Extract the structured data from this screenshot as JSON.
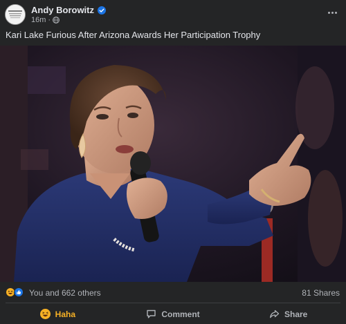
{
  "post": {
    "author": "Andy Borowitz",
    "timestamp": "16m",
    "separator": "·",
    "text": "Kari Lake Furious After Arizona Awards Her Participation Trophy"
  },
  "reactions": {
    "summary": "You and 662 others",
    "shares": "81 Shares"
  },
  "actions": {
    "haha_label": "Haha",
    "comment_label": "Comment",
    "share_label": "Share"
  },
  "icons": {
    "verified": "verified-badge-icon",
    "audience": "globe-icon",
    "more": "more-options-icon",
    "haha": "haha-reaction-icon",
    "like": "like-reaction-icon",
    "comment": "comment-bubble-icon",
    "share": "share-arrow-icon"
  },
  "colors": {
    "background": "#242526",
    "primary_text": "#e4e6eb",
    "secondary_text": "#b0b3b8",
    "verified_blue": "#1b74e4",
    "haha_yellow": "#f7b125",
    "divider": "#3e4042"
  }
}
